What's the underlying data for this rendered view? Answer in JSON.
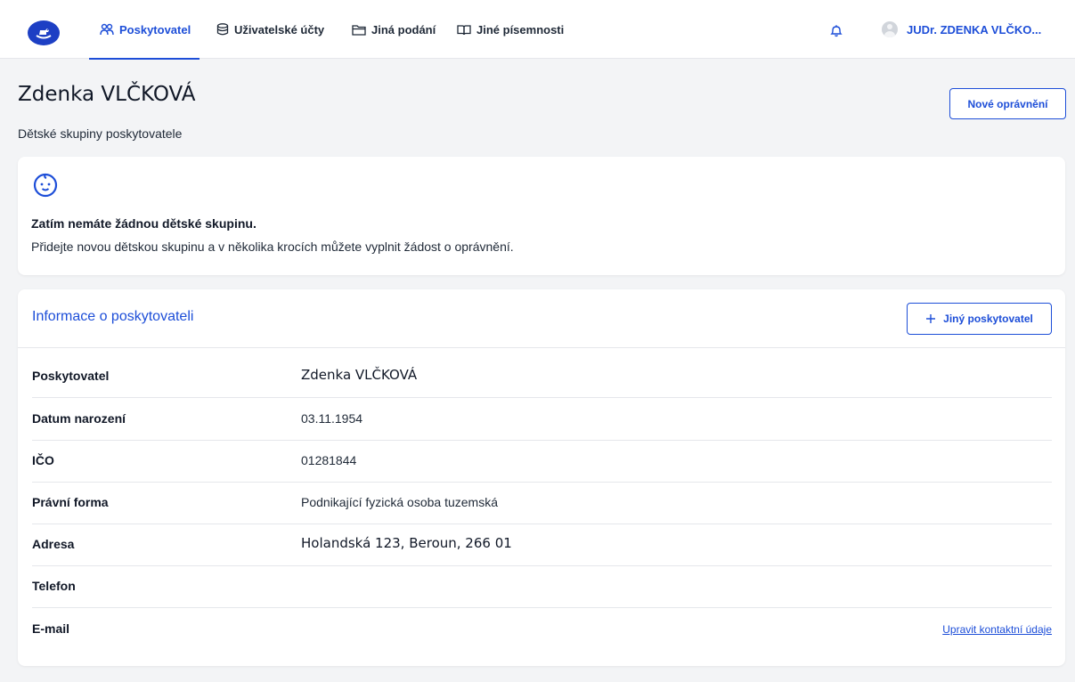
{
  "nav": {
    "items": [
      {
        "label": "Poskytovatel",
        "active": true
      },
      {
        "label": "Uživatelské účty"
      },
      {
        "label": "Jiná podání"
      },
      {
        "label": "Jiné písemnosti"
      }
    ],
    "user_name": "JUDr. ZDENKA VLČKO..."
  },
  "page": {
    "title": "Zdenka VLČKOVÁ",
    "subtitle": "Dětské skupiny poskytovatele",
    "new_permission_label": "Nové oprávnění"
  },
  "empty_state": {
    "title": "Zatím nemáte žádnou dětské skupinu.",
    "text": "Přidejte novou dětskou skupinu a v několika krocích můžete vyplnit žádost o oprávnění."
  },
  "info": {
    "title": "Informace o poskytovateli",
    "add_provider_label": "Jiný poskytovatel",
    "rows": [
      {
        "label": "Poskytovatel",
        "value": "Zdenka VLČKOVÁ"
      },
      {
        "label": "Datum narození",
        "value": "03.11.1954"
      },
      {
        "label": "IČO",
        "value": "01281844"
      },
      {
        "label": "Právní forma",
        "value": "Podnikající fyzická osoba tuzemská"
      },
      {
        "label": "Adresa",
        "value": "Holandská 123, Beroun, 266 01"
      },
      {
        "label": "Telefon",
        "value": ""
      },
      {
        "label": "E-mail",
        "value": ""
      }
    ],
    "edit_contact_label": "Upravit kontaktní údaje"
  },
  "colors": {
    "accent": "#1d4ed8",
    "logo_bg": "#1d3fc4",
    "background": "#f3f4f6"
  },
  "icons": [
    "rocking-horse-logo-icon",
    "users-icon",
    "database-icon",
    "folder-icon",
    "book-icon",
    "bell-icon",
    "baby-face-icon",
    "plus-icon"
  ]
}
